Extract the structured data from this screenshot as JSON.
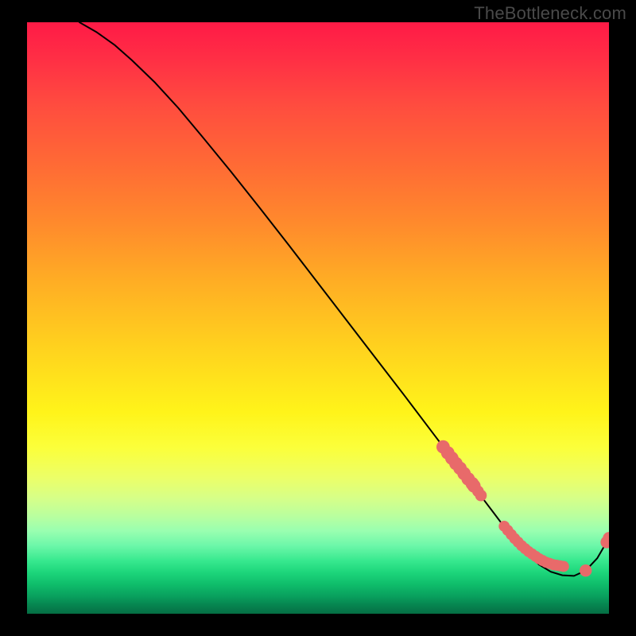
{
  "watermark": "TheBottleneck.com",
  "chart_data": {
    "type": "line",
    "title": "",
    "xlabel": "",
    "ylabel": "",
    "xlim": [
      0,
      100
    ],
    "ylim": [
      0,
      100
    ],
    "grid": false,
    "legend": false,
    "series": [
      {
        "name": "curve",
        "color": "#000000",
        "x": [
          9,
          12,
          15,
          18,
          22,
          26,
          30,
          35,
          40,
          45,
          50,
          55,
          60,
          65,
          70,
          72,
          74,
          76,
          78,
          80,
          82,
          84,
          86,
          88,
          90,
          92,
          94,
          96,
          98,
          100
        ],
        "y": [
          100,
          98.3,
          96.2,
          93.6,
          89.8,
          85.5,
          80.8,
          74.8,
          68.6,
          62.3,
          55.9,
          49.5,
          43.1,
          36.7,
          30.2,
          27.6,
          25.1,
          22.5,
          19.9,
          17.3,
          14.7,
          12.2,
          10.0,
          8.3,
          7.1,
          6.5,
          6.4,
          7.3,
          9.4,
          12.8
        ]
      }
    ],
    "points": [
      {
        "name": "cluster1",
        "color": "#e86a6a",
        "r": 1.15,
        "x": [
          71.5,
          72.3,
          73.0,
          73.7,
          74.4,
          75.1,
          75.8,
          76.5,
          76.8
        ],
        "y": [
          28.2,
          27.2,
          26.3,
          25.4,
          24.6,
          23.7,
          22.8,
          22.0,
          21.6
        ]
      },
      {
        "name": "cluster1b",
        "color": "#e86a6a",
        "r": 1.0,
        "x": [
          77.5,
          78.0
        ],
        "y": [
          20.7,
          20.0
        ]
      },
      {
        "name": "band",
        "color": "#e86a6a",
        "r": 0.95,
        "x": [
          82.0,
          82.6,
          83.2,
          83.8,
          84.4,
          85.0,
          85.6,
          86.2,
          86.8,
          87.4,
          88.0,
          88.6,
          89.2,
          89.8,
          90.4,
          91.0,
          91.6,
          92.2
        ],
        "y": [
          14.8,
          14.1,
          13.4,
          12.7,
          12.1,
          11.5,
          11.0,
          10.5,
          10.1,
          9.7,
          9.3,
          9.0,
          8.7,
          8.5,
          8.3,
          8.2,
          8.1,
          8.0
        ]
      },
      {
        "name": "tail",
        "color": "#e86a6a",
        "r": 1.05,
        "x": [
          96.0,
          99.6,
          100.0
        ],
        "y": [
          7.3,
          12.1,
          12.8
        ]
      }
    ]
  }
}
